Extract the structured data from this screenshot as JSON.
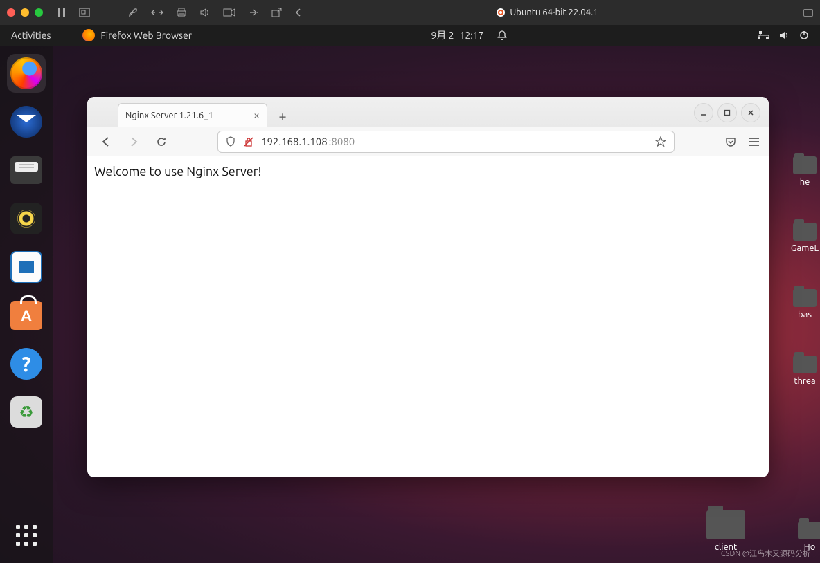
{
  "host": {
    "title": "Ubuntu 64-bit 22.04.1"
  },
  "topbar": {
    "activities": "Activities",
    "app_label": "Firefox Web Browser",
    "date": "9月 2",
    "time": "12:17"
  },
  "desktop_folders": [
    {
      "label": "he"
    },
    {
      "label": "GameL"
    },
    {
      "label": "bas"
    },
    {
      "label": "threa"
    }
  ],
  "bottom_folder": {
    "label": "client"
  },
  "home_folder": {
    "label": "Ho"
  },
  "firefox": {
    "tab_title": "Nginx Server 1.21.6_1",
    "address_host": "192.168.1.108",
    "address_port": ":8080",
    "page_text": "Welcome to use Nginx Server!"
  },
  "watermark": "CSDN @江鸟木又源码分析"
}
